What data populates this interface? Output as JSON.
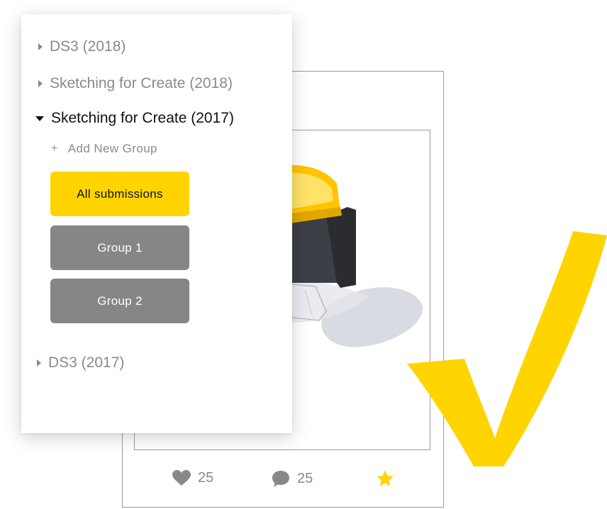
{
  "tree": {
    "items": [
      {
        "label": "DS3 (2018)",
        "expanded": false
      },
      {
        "label": "Sketching for Create (2018)",
        "expanded": false
      },
      {
        "label": "Sketching for Create (2017)",
        "expanded": true
      },
      {
        "label": "DS3 (2017)",
        "expanded": false
      }
    ],
    "add_group_icon": "+",
    "add_group_label": "Add New Group",
    "groups": [
      {
        "label": "All submissions",
        "active": true
      },
      {
        "label": "Group 1",
        "active": false
      },
      {
        "label": "Group 2",
        "active": false
      }
    ]
  },
  "card": {
    "likes": "25",
    "comments": "25",
    "starred": true
  },
  "colors": {
    "accent": "#FFD400",
    "inactive_button": "#868686",
    "muted_text": "#8a8a8a"
  },
  "icons": [
    "caret-right-icon",
    "caret-down-icon",
    "plus-icon",
    "heart-icon",
    "comment-icon",
    "star-icon",
    "checkmark-icon"
  ]
}
